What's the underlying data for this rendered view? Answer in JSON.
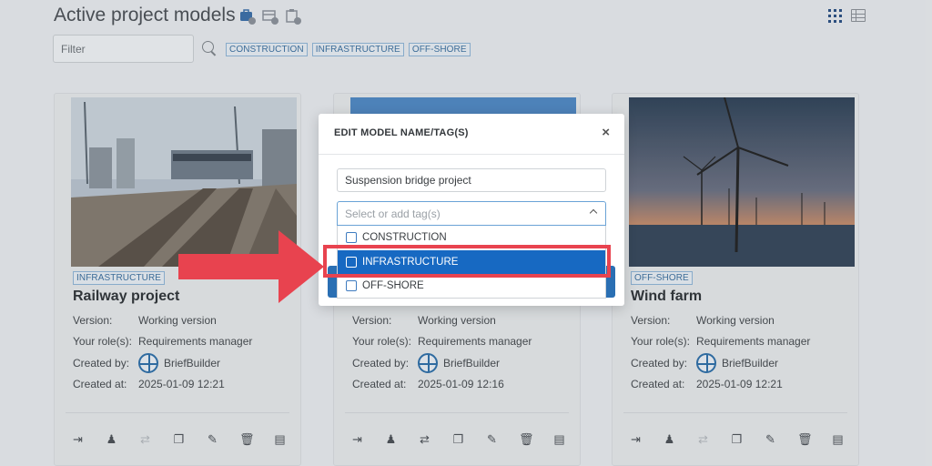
{
  "header": {
    "title": "Active project models",
    "filter_placeholder": "Filter",
    "tags": [
      "CONSTRUCTION",
      "INFRASTRUCTURE",
      "OFF-SHORE"
    ]
  },
  "cards": [
    {
      "tag": "INFRASTRUCTURE",
      "title": "Railway project",
      "version_label": "Version:",
      "version": "Working version",
      "role_label": "Your role(s):",
      "role": "Requirements manager",
      "created_by_label": "Created by:",
      "created_by": "BriefBuilder",
      "created_at_label": "Created at:",
      "created_at": "2025-01-09 12:21"
    },
    {
      "tag": "",
      "title": "",
      "version_label": "Version:",
      "version": "Working version",
      "role_label": "Your role(s):",
      "role": "Requirements manager",
      "created_by_label": "Created by:",
      "created_by": "BriefBuilder",
      "created_at_label": "Created at:",
      "created_at": "2025-01-09 12:16"
    },
    {
      "tag": "OFF-SHORE",
      "title": "Wind farm",
      "version_label": "Version:",
      "version": "Working version",
      "role_label": "Your role(s):",
      "role": "Requirements manager",
      "created_by_label": "Created by:",
      "created_by": "BriefBuilder",
      "created_at_label": "Created at:",
      "created_at": "2025-01-09 12:21"
    }
  ],
  "modal": {
    "title": "EDIT MODEL NAME/TAG(S)",
    "close": "×",
    "name_value": "Suspension bridge project",
    "tag_placeholder": "Select or add tag(s)",
    "options": [
      "CONSTRUCTION",
      "INFRASTRUCTURE",
      "OFF-SHORE"
    ],
    "highlighted_option": "INFRASTRUCTURE"
  },
  "colors": {
    "accent": "#1769c2",
    "highlight": "#e8434f",
    "tag_text": "#3c6f9e"
  }
}
